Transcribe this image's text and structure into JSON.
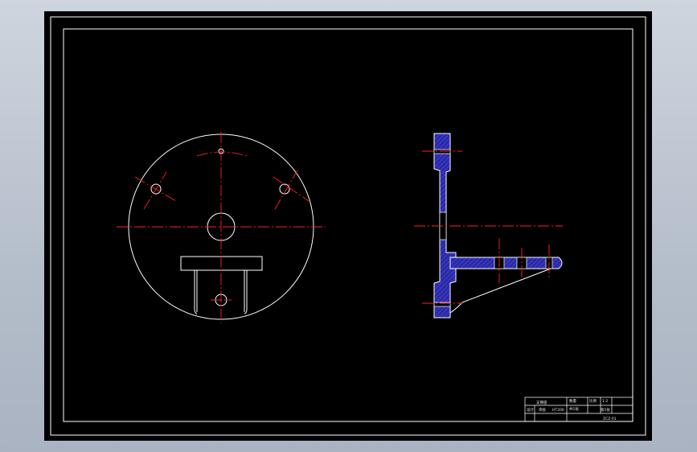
{
  "sheet": {
    "background": "#000000",
    "line_color": "#ffffff",
    "centerline_color": "#ff2020",
    "hatch_color": "#2a2aa8"
  },
  "views": {
    "front": {
      "name": "front-view",
      "features": [
        "outer-circle",
        "center-hole",
        "bolt-hole-left",
        "bolt-hole-right",
        "top-pin-hole",
        "mounting-block",
        "bottom-slot"
      ]
    },
    "side": {
      "name": "side-section-view",
      "features": [
        "vertical-plate-section",
        "horizontal-arm-section",
        "support-rib",
        "arm-holes"
      ]
    }
  },
  "title_block": {
    "part_name": "支撑座",
    "material": "HT200",
    "designer": "设计",
    "checker": "审核",
    "scale_label": "比例",
    "scale": "1:2",
    "sheet_label": "共1张",
    "quantity": "数量",
    "drawing_no": "ZCZ-01",
    "sheet_no": "第1张"
  }
}
